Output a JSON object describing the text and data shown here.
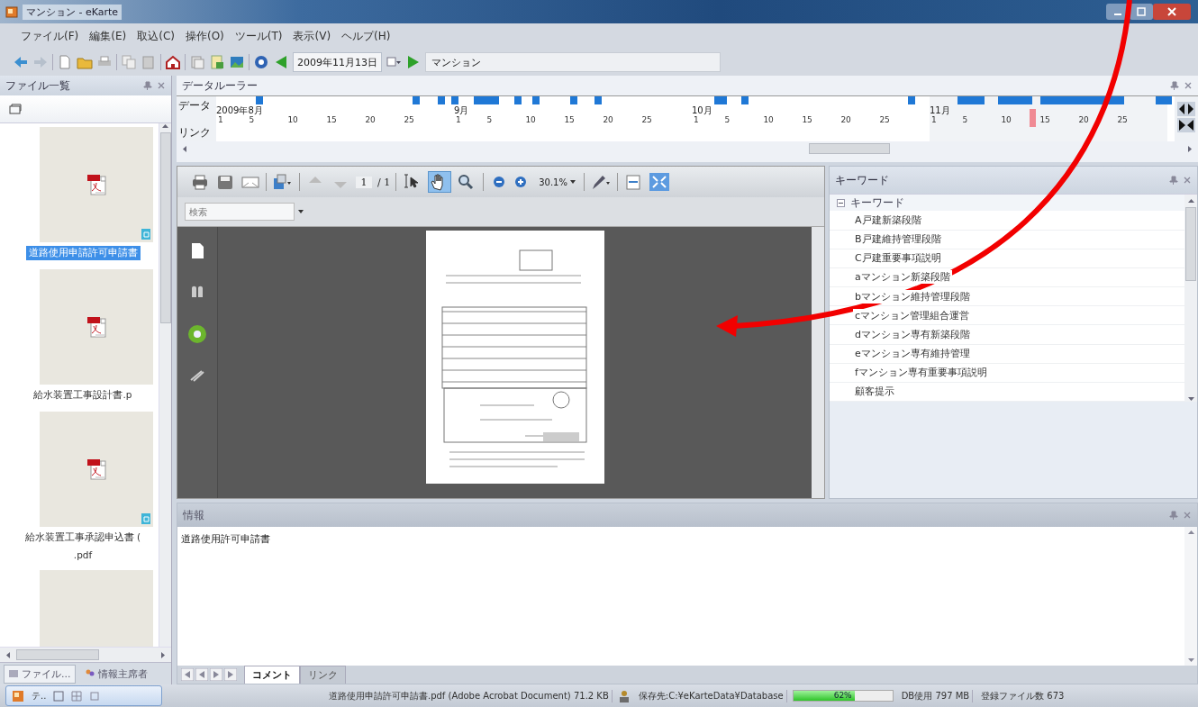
{
  "window": {
    "title": "マンション - eKarte"
  },
  "menu": [
    "ファイル(F)",
    "編集(E)",
    "取込(C)",
    "操作(O)",
    "ツール(T)",
    "表示(V)",
    "ヘルプ(H)"
  ],
  "toolbar": {
    "date": "2009年11月13日",
    "context": "マンション"
  },
  "file_panel": {
    "title": "ファイル一覧",
    "files": [
      {
        "lines": [
          "道路使用申請許可申請書"
        ],
        "selected": true,
        "linked": true
      },
      {
        "lines": [
          "給水装置工事設計書.p"
        ],
        "selected": false,
        "linked": false
      },
      {
        "lines": [
          "給水装置工事承認申込書 (",
          ".pdf"
        ],
        "selected": false,
        "linked": true
      }
    ],
    "tabs": [
      {
        "label": "ファイル...",
        "selected": true
      },
      {
        "label": "情報主席者",
        "selected": false
      }
    ]
  },
  "data_ruler": {
    "title": "データルーラー",
    "row_labels": [
      "データ",
      "リンク"
    ],
    "months": [
      {
        "label": "2009年8月",
        "days": [
          "1",
          "5",
          "10",
          "15",
          "20",
          "25"
        ]
      },
      {
        "label": "9月",
        "days": [
          "1",
          "5",
          "10",
          "15",
          "20",
          "25"
        ]
      },
      {
        "label": "10月",
        "days": [
          "1",
          "5",
          "10",
          "15",
          "20",
          "25"
        ]
      },
      {
        "label": "11月",
        "days": [
          "1",
          "5",
          "10",
          "15",
          "20",
          "25"
        ]
      }
    ]
  },
  "viewer": {
    "page": "1",
    "page_count": "/ 1",
    "zoom": "30.1%",
    "search_placeholder": "検索",
    "tools": [
      {
        "kind": "select",
        "selected": false
      },
      {
        "kind": "hand",
        "selected": true
      },
      {
        "kind": "zoom",
        "selected": false
      }
    ],
    "fit_selected": true
  },
  "keywords": {
    "title": "キーワード",
    "root": {
      "label": "キーワード",
      "expanded": true,
      "children": [
        {
          "label": "A戸建新築段階"
        },
        {
          "label": "B戸建維持管理段階"
        },
        {
          "label": "C戸建重要事項説明"
        },
        {
          "label": "aマンション新築段階"
        },
        {
          "label": "bマンション維持管理段階"
        },
        {
          "label": "cマンション管理組合運営"
        },
        {
          "label": "dマンション専有新築段階"
        },
        {
          "label": "eマンション専有維持管理"
        },
        {
          "label": "fマンション専有重要事項説明"
        },
        {
          "label": "顧客提示"
        }
      ]
    }
  },
  "info": {
    "title": "情報",
    "comment": "道路使用許可申請書",
    "tabs": [
      {
        "label": "コメント",
        "selected": true
      },
      {
        "label": "リンク",
        "selected": false
      }
    ]
  },
  "taskbar": {
    "label": "テ.."
  },
  "status_bar": {
    "file": "道路使用申請許可申請書.pdf (Adobe Acrobat Document) 71.2 KB",
    "storage": "保存先:C:¥eKarteData¥Database",
    "usage": {
      "level": 0.62,
      "reading": "62%"
    },
    "db": "DB使用 797 MB",
    "file_count": "登録ファイル数 673"
  }
}
